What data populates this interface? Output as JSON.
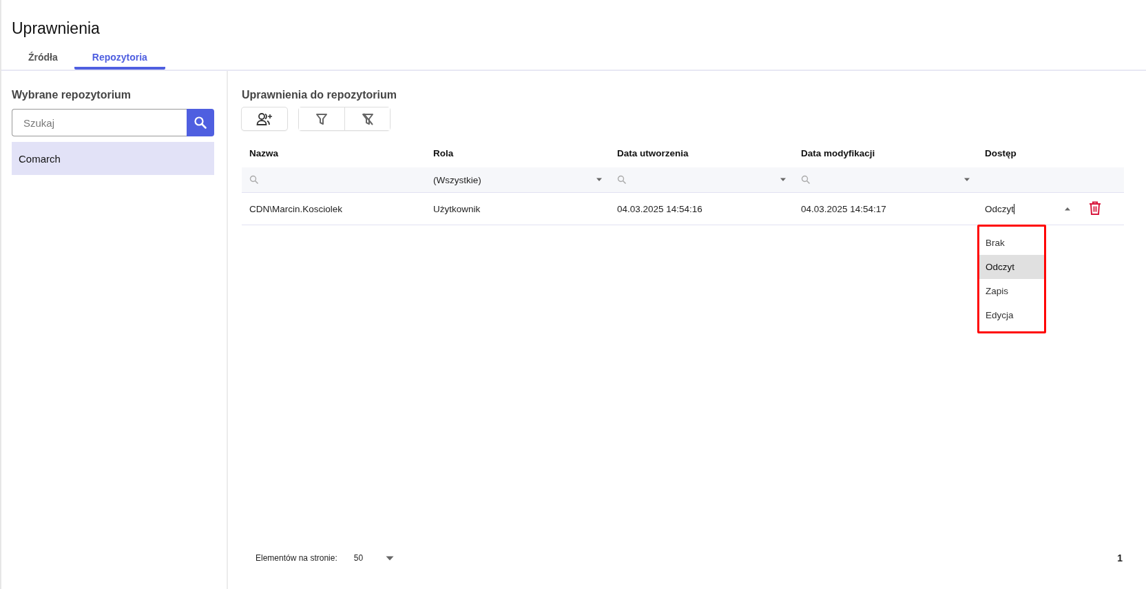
{
  "page": {
    "title": "Uprawnienia"
  },
  "tabs": [
    {
      "label": "Źródła",
      "selected": false
    },
    {
      "label": "Repozytoria",
      "selected": true
    }
  ],
  "sidebar": {
    "title": "Wybrane repozytorium",
    "search": {
      "placeholder": "Szukaj"
    },
    "items": [
      {
        "label": "Comarch",
        "selected": true
      }
    ]
  },
  "main": {
    "title": "Uprawnienia do repozytorium",
    "table": {
      "columns": [
        "Nazwa",
        "Rola",
        "Data utworzenia",
        "Data modyfikacji",
        "Dostęp"
      ],
      "filters": [
        {
          "kind": "search"
        },
        {
          "kind": "select",
          "value": "(Wszystkie)"
        },
        {
          "kind": "search-select"
        },
        {
          "kind": "search-select"
        },
        {
          "kind": "none"
        }
      ],
      "rows": [
        {
          "name": "CDN\\Marcin.Kosciolek",
          "role": "Użytkownik",
          "created": "04.03.2025 14:54:16",
          "modified": "04.03.2025 14:54:17",
          "access": "Odczyt",
          "expanded": true
        }
      ]
    },
    "access_options": [
      {
        "label": "Brak",
        "selected": false
      },
      {
        "label": "Odczyt",
        "selected": true
      },
      {
        "label": "Zapis",
        "selected": false
      },
      {
        "label": "Edycja",
        "selected": false
      }
    ],
    "pager": {
      "label": "Elementów na stronie:",
      "page_size": "50",
      "page": "1"
    }
  }
}
